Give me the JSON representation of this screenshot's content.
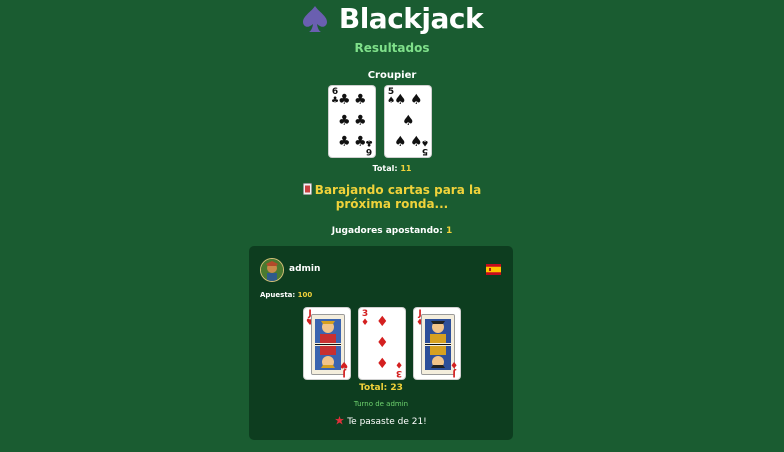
{
  "app": {
    "title": "Blackjack",
    "logo_icon": "spade-icon"
  },
  "results_label": "Resultados",
  "dealer": {
    "label": "Croupier",
    "cards": [
      {
        "rank": "6",
        "suit": "clubs",
        "symbol": "♣"
      },
      {
        "rank": "5",
        "suit": "spades",
        "symbol": "♠"
      }
    ],
    "total_label": "Total:",
    "total_value": "11"
  },
  "shuffle_message": {
    "icon": "card-icon",
    "line1": "Barajando cartas para la",
    "line2": "próxima ronda..."
  },
  "bettors": {
    "label": "Jugadores apostando:",
    "count": "1"
  },
  "player": {
    "name": "admin",
    "avatar_icon": "avatar-icon",
    "flag": "spain-flag-icon",
    "bet_label": "Apuesta:",
    "bet_value": "100",
    "cards": [
      {
        "rank": "J",
        "suit": "hearts",
        "symbol": "♥"
      },
      {
        "rank": "3",
        "suit": "diamonds",
        "symbol": "♦"
      },
      {
        "rank": "J",
        "suit": "diamonds",
        "symbol": "♦"
      }
    ],
    "total_label": "Total:",
    "total_value": "23",
    "turn_text": "Turno de admin",
    "bust_icon": "explosion-icon",
    "bust_text": "Te pasaste de 21!"
  },
  "colors": {
    "background": "#1a5c31",
    "panel": "#0d3d1f",
    "accent_yellow": "#f0d23a",
    "accent_green": "#7fe08a",
    "suit_red": "#d42020"
  }
}
